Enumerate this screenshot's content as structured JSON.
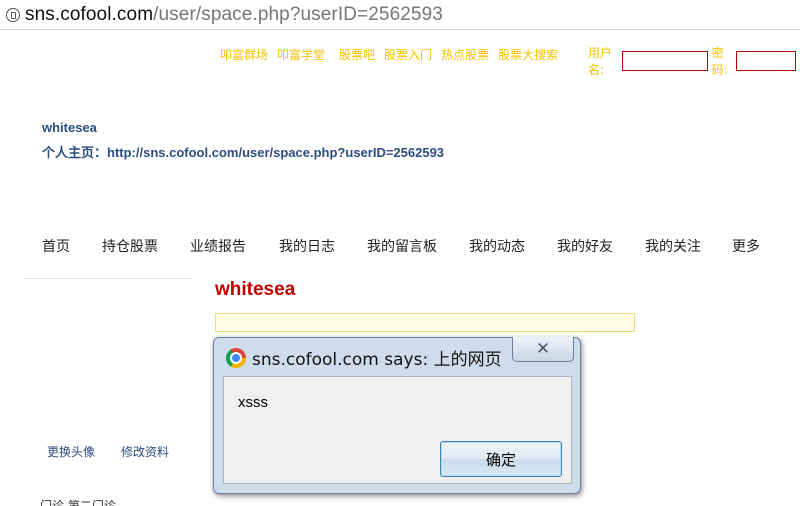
{
  "browser": {
    "url_host": "sns.cofool.com",
    "url_path": "/user/space.php?userID=2562593"
  },
  "top_links": [
    "叩富群场",
    "叩富学堂",
    "股票吧",
    "股票入门",
    "热点股票",
    "股票大搜索"
  ],
  "login": {
    "username_label": "用户名:",
    "password_label": "密码:",
    "username_value": "",
    "password_value": ""
  },
  "profile": {
    "username": "whitesea",
    "homepage_label": "个人主页：",
    "homepage_url": "http://sns.cofool.com/user/space.php?userID=2562593"
  },
  "nav": {
    "items": [
      "首页",
      "持仓股票",
      "业绩报告",
      "我的日志",
      "我的留言板",
      "我的动态",
      "我的好友",
      "我的关注",
      "更多"
    ]
  },
  "main": {
    "title": "whitesea",
    "box_text": ""
  },
  "sidebar": {
    "change_avatar": "更换头像",
    "edit_profile": "修改资料",
    "cutoff_text": "门诊  第二门诊"
  },
  "dialog": {
    "title": "sns.cofool.com says: 上的网页",
    "message": "xsss",
    "ok_label": "确定",
    "close_glyph": "✕"
  },
  "icons": {
    "page": "page-icon",
    "chrome": "chrome-icon",
    "close": "close-icon"
  },
  "colors": {
    "top_link": "#f2c100",
    "profile_text": "#2c4d80",
    "main_title": "#c00000"
  }
}
